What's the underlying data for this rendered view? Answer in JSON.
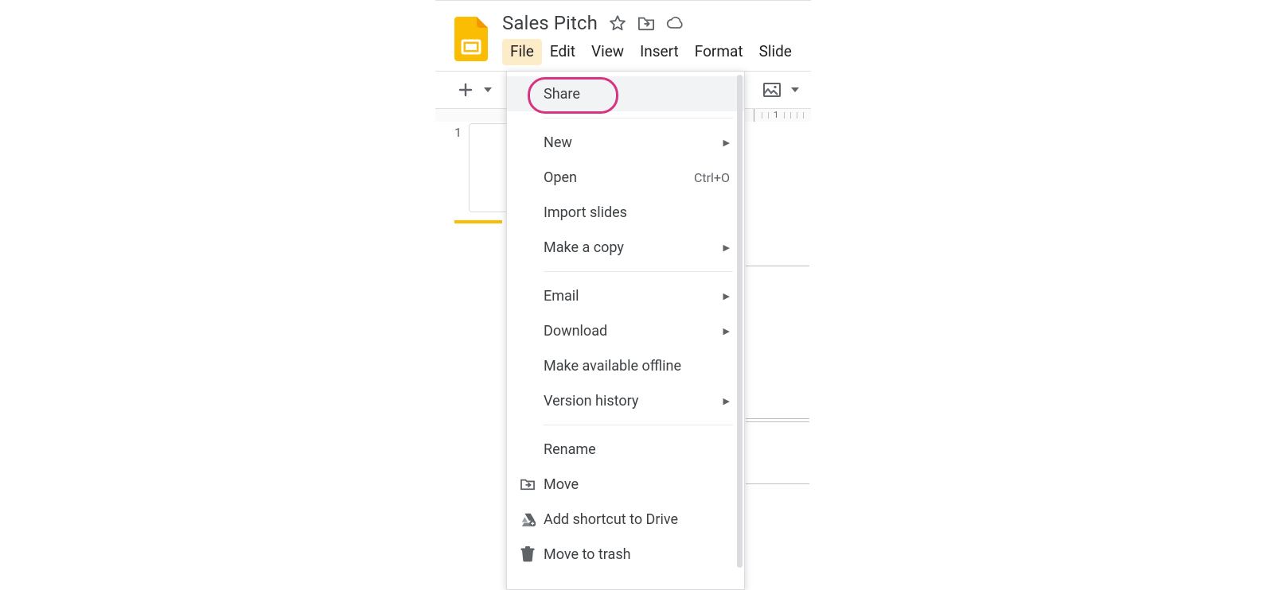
{
  "doc": {
    "title": "Sales Pitch"
  },
  "menubar": {
    "items": [
      "File",
      "Edit",
      "View",
      "Insert",
      "Format",
      "Slide"
    ],
    "active_index": 0
  },
  "ruler": {
    "label": "1"
  },
  "thumbnails": {
    "first_index": "1"
  },
  "dropdown": {
    "share": "Share",
    "new": "New",
    "open": "Open",
    "open_shortcut": "Ctrl+O",
    "import_slides": "Import slides",
    "make_copy": "Make a copy",
    "email": "Email",
    "download": "Download",
    "offline": "Make available offline",
    "version_history": "Version history",
    "rename": "Rename",
    "move": "Move",
    "add_shortcut": "Add shortcut to Drive",
    "trash": "Move to trash"
  }
}
